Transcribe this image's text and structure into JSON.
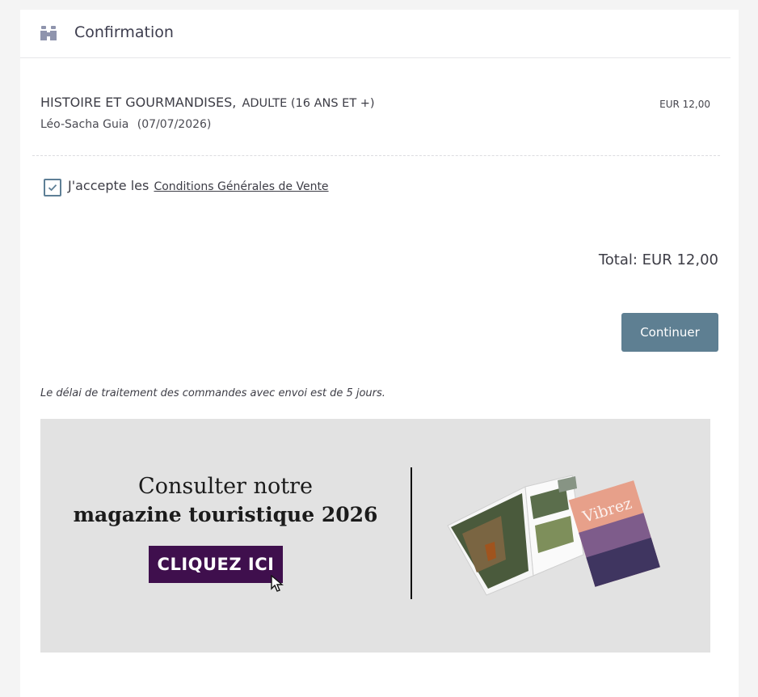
{
  "header": {
    "icon": "binoculars-icon",
    "title": "Confirmation"
  },
  "order_item": {
    "title": "HISTOIRE ET GOURMANDISES,",
    "category": "ADULTE (16 ANS ET +)",
    "participant": "Léo-Sacha Guia",
    "date": "(07/07/2026)",
    "price": "EUR 12,00"
  },
  "terms": {
    "checked": true,
    "prefix": "J'accepte les",
    "link_label": "Conditions Générales de Vente"
  },
  "total": {
    "label": "Total: EUR 12,00"
  },
  "actions": {
    "continue_label": "Continuer"
  },
  "note": "Le délai de traitement des commandes avec envoi est de 5 jours.",
  "banner": {
    "line1": "Consulter notre",
    "line2": "magazine touristique 2026",
    "cta": "CLIQUEZ ICI",
    "magazine_cover_title": "Vibrez",
    "colors": {
      "background": "#e2e2e2",
      "cta": "#3f0f4d"
    }
  },
  "colors": {
    "accent": "#5e7f92",
    "text": "#3d3d46"
  }
}
